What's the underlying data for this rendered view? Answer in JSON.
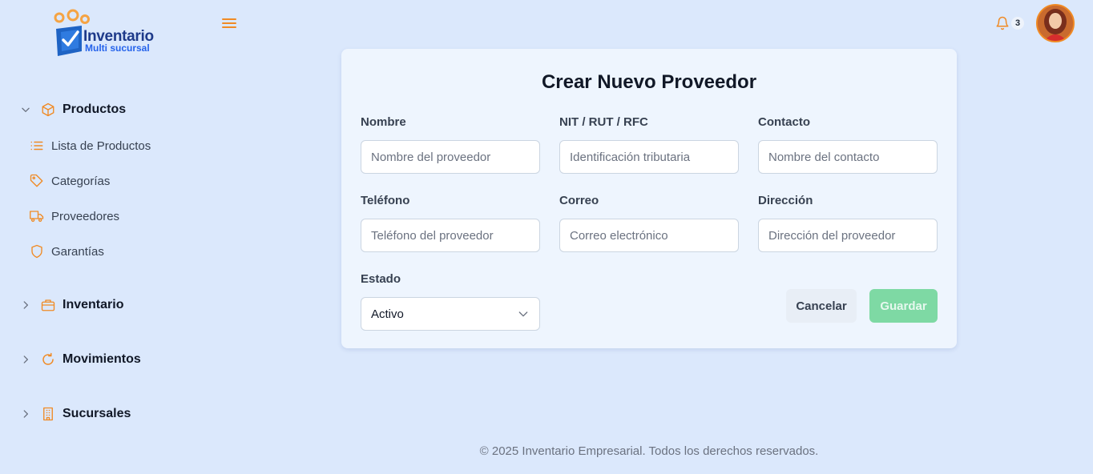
{
  "brand": {
    "name": "Inventario",
    "tagline": "Multi sucursal",
    "accent": "#f08a24"
  },
  "header": {
    "menu_icon": "hamburger-icon",
    "notifications_icon": "bell-icon",
    "notifications_count": "3"
  },
  "sidebar": {
    "groups": [
      {
        "label": "Productos",
        "icon": "box-icon",
        "expanded": true,
        "items": [
          {
            "label": "Lista de Productos",
            "icon": "list-icon"
          },
          {
            "label": "Categorías",
            "icon": "tag-icon"
          },
          {
            "label": "Proveedores",
            "icon": "truck-icon"
          },
          {
            "label": "Garantías",
            "icon": "shield-icon"
          }
        ]
      },
      {
        "label": "Inventario",
        "icon": "briefcase-icon",
        "expanded": false
      },
      {
        "label": "Movimientos",
        "icon": "refresh-icon",
        "expanded": false
      },
      {
        "label": "Sucursales",
        "icon": "building-icon",
        "expanded": false
      }
    ]
  },
  "form": {
    "title": "Crear Nuevo Proveedor",
    "fields": {
      "nombre": {
        "label": "Nombre",
        "placeholder": "Nombre del proveedor"
      },
      "nit": {
        "label": "NIT / RUT / RFC",
        "placeholder": "Identificación tributaria"
      },
      "contacto": {
        "label": "Contacto",
        "placeholder": "Nombre del contacto"
      },
      "telefono": {
        "label": "Teléfono",
        "placeholder": "Teléfono del proveedor"
      },
      "correo": {
        "label": "Correo",
        "placeholder": "Correo electrónico"
      },
      "direccion": {
        "label": "Dirección",
        "placeholder": "Dirección del proveedor"
      },
      "estado": {
        "label": "Estado",
        "value": "Activo"
      }
    },
    "cancel_label": "Cancelar",
    "save_label": "Guardar",
    "save_color": "#7ed9a4"
  },
  "footer": {
    "text": "© 2025 Inventario Empresarial. Todos los derechos reservados."
  }
}
